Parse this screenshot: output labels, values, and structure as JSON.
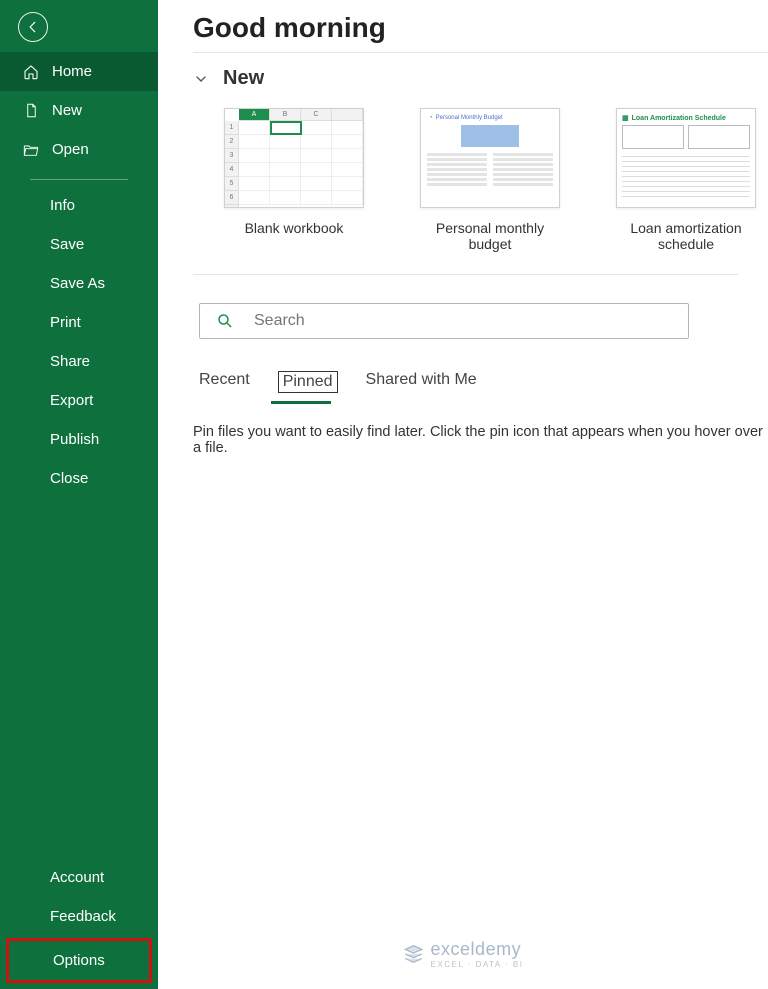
{
  "sidebar": {
    "home": "Home",
    "new": "New",
    "open": "Open",
    "info": "Info",
    "save": "Save",
    "save_as": "Save As",
    "print": "Print",
    "share": "Share",
    "export": "Export",
    "publish": "Publish",
    "close": "Close",
    "account": "Account",
    "feedback": "Feedback",
    "options": "Options"
  },
  "main": {
    "greeting": "Good morning",
    "section_new": "New",
    "templates": [
      {
        "label": "Blank workbook"
      },
      {
        "label": "Personal monthly budget"
      },
      {
        "label": "Loan amortization schedule"
      }
    ],
    "budget_thumb_title": "Personal Monthly Budget",
    "loan_thumb_title": "Loan Amortization Schedule",
    "search_placeholder": "Search",
    "tabs": {
      "recent": "Recent",
      "pinned": "Pinned",
      "shared": "Shared with Me",
      "active": "pinned"
    },
    "pinned_hint": "Pin files you want to easily find later. Click the pin icon that appears when you hover over a file."
  },
  "watermark": {
    "brand": "exceldemy",
    "tagline": "EXCEL · DATA · BI"
  }
}
